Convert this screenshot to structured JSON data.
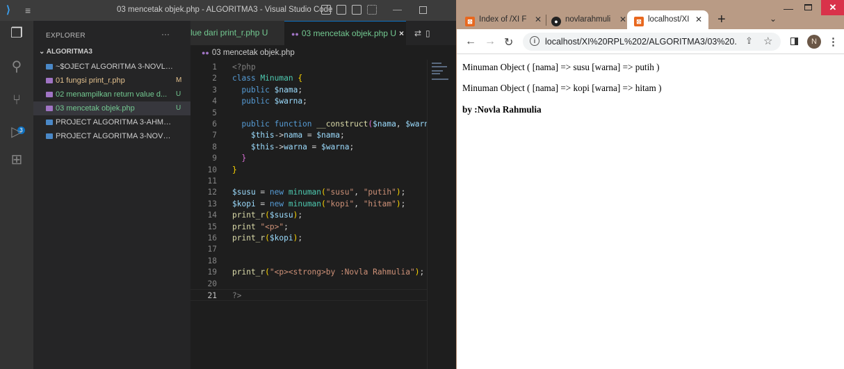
{
  "vscode": {
    "title": "03 mencetak objek.php - ALGORITMA3 - Visual Studio Code",
    "activity_badge": "3",
    "sidebar": {
      "header": "EXPLORER",
      "more": "···",
      "root": "ALGORITMA3",
      "items": [
        {
          "label": "~$OJECT ALGORITMA 3-NOVLA RA...",
          "badge": "",
          "color": "#cccccc",
          "icon_color": "#4a88c7"
        },
        {
          "label": "01 fungsi print_r.php",
          "badge": "M",
          "color": "#e2c08d",
          "icon_color": "#a074c4"
        },
        {
          "label": "02 menampilkan return value d...",
          "badge": "U",
          "color": "#73c991",
          "icon_color": "#a074c4"
        },
        {
          "label": "03 mencetak objek.php",
          "badge": "U",
          "color": "#73c991",
          "icon_color": "#a074c4"
        },
        {
          "label": "PROJECT ALGORITMA 3-AHMADI M...",
          "badge": "",
          "color": "#cccccc",
          "icon_color": "#4a88c7"
        },
        {
          "label": "PROJECT ALGORITMA 3-NOVLA RA...",
          "badge": "",
          "color": "#cccccc",
          "icon_color": "#4a88c7"
        }
      ]
    },
    "tabs": [
      {
        "label": "lue dari print_r.php",
        "badge": "U"
      },
      {
        "label": "03 mencetak objek.php",
        "badge": "U",
        "close": "×"
      }
    ],
    "breadcrumb": "03 mencetak objek.php",
    "code": [
      {
        "n": "1",
        "html": "<span class='p'>&lt;?php</span>"
      },
      {
        "n": "2",
        "html": "<span class='k'>class</span> <span class='t'>Minuman</span> <span class='b'>{</span>"
      },
      {
        "n": "3",
        "html": "  <span class='k'>public</span> <span class='v'>$nama</span>;"
      },
      {
        "n": "4",
        "html": "  <span class='k'>public</span> <span class='v'>$warna</span>;"
      },
      {
        "n": "5",
        "html": ""
      },
      {
        "n": "6",
        "html": "  <span class='k'>public function</span> <span class='f'>__construct</span><span class='b2'>(</span><span class='v'>$nama</span>, <span class='v'>$warn</span>"
      },
      {
        "n": "7",
        "html": "    <span class='v'>$this</span>-&gt;<span class='v'>nama</span> = <span class='v'>$nama</span>;"
      },
      {
        "n": "8",
        "html": "    <span class='v'>$this</span>-&gt;<span class='v'>warna</span> = <span class='v'>$warna</span>;"
      },
      {
        "n": "9",
        "html": "  <span class='b2'>}</span>"
      },
      {
        "n": "10",
        "html": "<span class='b'>}</span>"
      },
      {
        "n": "11",
        "html": ""
      },
      {
        "n": "12",
        "html": "<span class='v'>$susu</span> = <span class='k'>new</span> <span class='t'>minuman</span><span class='b'>(</span><span class='s'>\"susu\"</span>, <span class='s'>\"putih\"</span><span class='b'>)</span>;"
      },
      {
        "n": "13",
        "html": "<span class='v'>$kopi</span> = <span class='k'>new</span> <span class='t'>minuman</span><span class='b'>(</span><span class='s'>\"kopi\"</span>, <span class='s'>\"hitam\"</span><span class='b'>)</span>;"
      },
      {
        "n": "14",
        "html": "<span class='f'>print_r</span><span class='b'>(</span><span class='v'>$susu</span><span class='b'>)</span>;"
      },
      {
        "n": "15",
        "html": "<span class='f'>print</span> <span class='s'>\"&lt;p&gt;\"</span>;"
      },
      {
        "n": "16",
        "html": "<span class='f'>print_r</span><span class='b'>(</span><span class='v'>$kopi</span><span class='b'>)</span>;"
      },
      {
        "n": "17",
        "html": ""
      },
      {
        "n": "18",
        "html": ""
      },
      {
        "n": "19",
        "html": "<span class='f'>print_r</span><span class='b'>(</span><span class='s'>\"&lt;p&gt;&lt;strong&gt;by :Novla Rahmulia\"</span><span class='b'>)</span>;"
      },
      {
        "n": "20",
        "html": ""
      },
      {
        "n": "21",
        "html": "<span class='p'>?&gt;</span>"
      }
    ]
  },
  "chrome": {
    "tabs": [
      {
        "label": "Index of /XI F",
        "fav": "#e8681f"
      },
      {
        "label": "novlarahmuli",
        "fav": "#222222"
      },
      {
        "label": "localhost/XI",
        "fav": "#e8681f"
      }
    ],
    "new_tab": "+",
    "url": "localhost/XI%20RPL%202/ALGORITMA3/03%20...",
    "avatar_initial": "N",
    "output": [
      "Minuman Object ( [nama] => susu [warna] => putih )",
      "Minuman Object ( [nama] => kopi [warna] => hitam )",
      "by :Novla Rahmulia"
    ]
  }
}
